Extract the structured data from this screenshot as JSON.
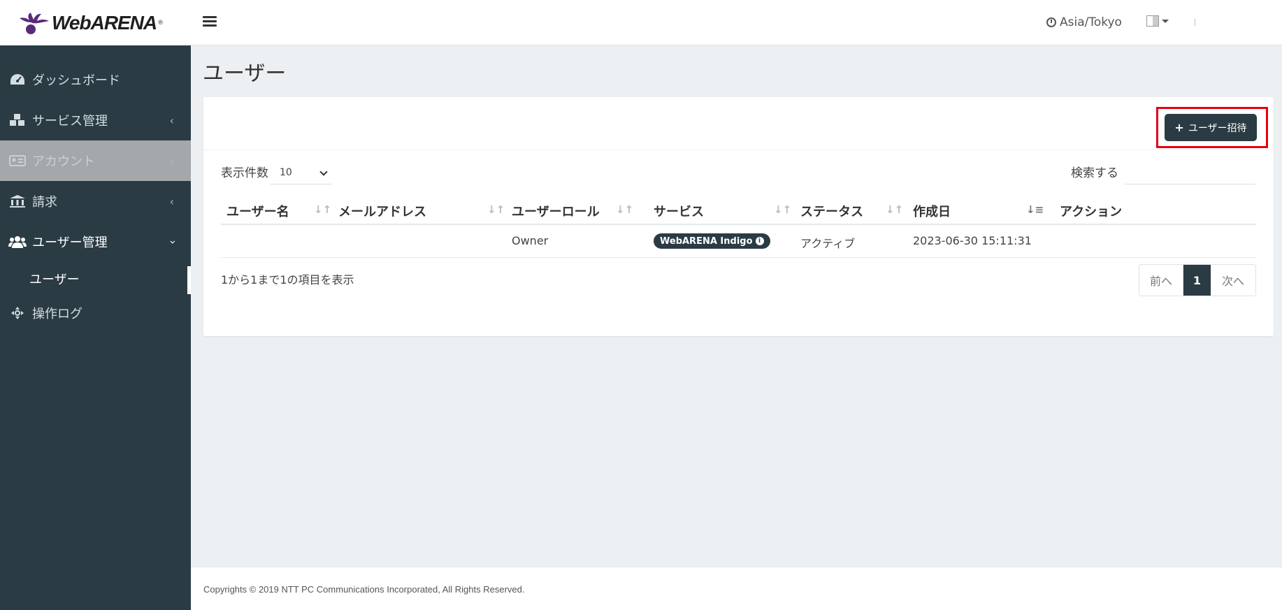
{
  "brand": {
    "name": "WebARENA",
    "reg": "®"
  },
  "header": {
    "timezone": "Asia/Tokyo"
  },
  "sidebar": {
    "items": [
      {
        "label": "ダッシュボード"
      },
      {
        "label": "サービス管理"
      },
      {
        "label": "アカウント"
      },
      {
        "label": "請求"
      },
      {
        "label": "ユーザー管理"
      },
      {
        "label": "ユーザー"
      },
      {
        "label": "操作ログ"
      }
    ]
  },
  "page": {
    "title": "ユーザー"
  },
  "toolbar": {
    "invite_label": "ユーザー招待"
  },
  "table_controls": {
    "length_label": "表示件数",
    "length_value": "10",
    "search_label": "検索する",
    "search_value": ""
  },
  "table": {
    "columns": [
      "ユーザー名",
      "メールアドレス",
      "ユーザーロール",
      "サービス",
      "ステータス",
      "作成日",
      "アクション"
    ],
    "rows": [
      {
        "username": "",
        "email": "",
        "role": "Owner",
        "service": "WebARENA Indigo",
        "status": "アクティブ",
        "created": "2023-06-30 15:11:31",
        "action": ""
      }
    ],
    "info": "1から1まで1の項目を表示"
  },
  "pagination": {
    "prev": "前へ",
    "current": "1",
    "next": "次へ"
  },
  "footer": {
    "text": "Copyrights © 2019 NTT PC Communications Incorporated, All Rights Reserved."
  },
  "colors": {
    "sidebar": "#2a3b44",
    "accent": "#2a3b44",
    "highlight": "#e60012"
  }
}
